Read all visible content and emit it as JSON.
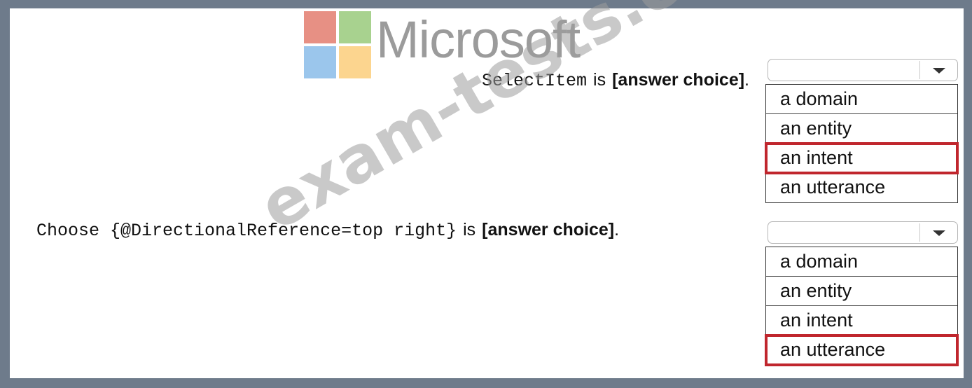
{
  "logo": {
    "wordmark": "Microsoft",
    "colors": [
      "#e06b5b",
      "#8cc46a",
      "#7ab3e6",
      "#fcc86a"
    ]
  },
  "watermark": "exam-tests.com",
  "questions": [
    {
      "statement_code": "SelectItem",
      "statement_is": "is",
      "answer_placeholder": "[answer choice]",
      "period": ".",
      "dropdown_value": "",
      "options": [
        "a domain",
        "an entity",
        "an intent",
        "an utterance"
      ],
      "selected": "an intent"
    },
    {
      "statement_code": "Choose {@DirectionalReference=top right}",
      "statement_is": "is",
      "answer_placeholder": "[answer choice]",
      "period": ".",
      "dropdown_value": "",
      "options": [
        "a domain",
        "an entity",
        "an intent",
        "an utterance"
      ],
      "selected": "an utterance"
    }
  ],
  "colors": {
    "frame": "#6e7b8b",
    "selection_outline": "#c0262d"
  }
}
